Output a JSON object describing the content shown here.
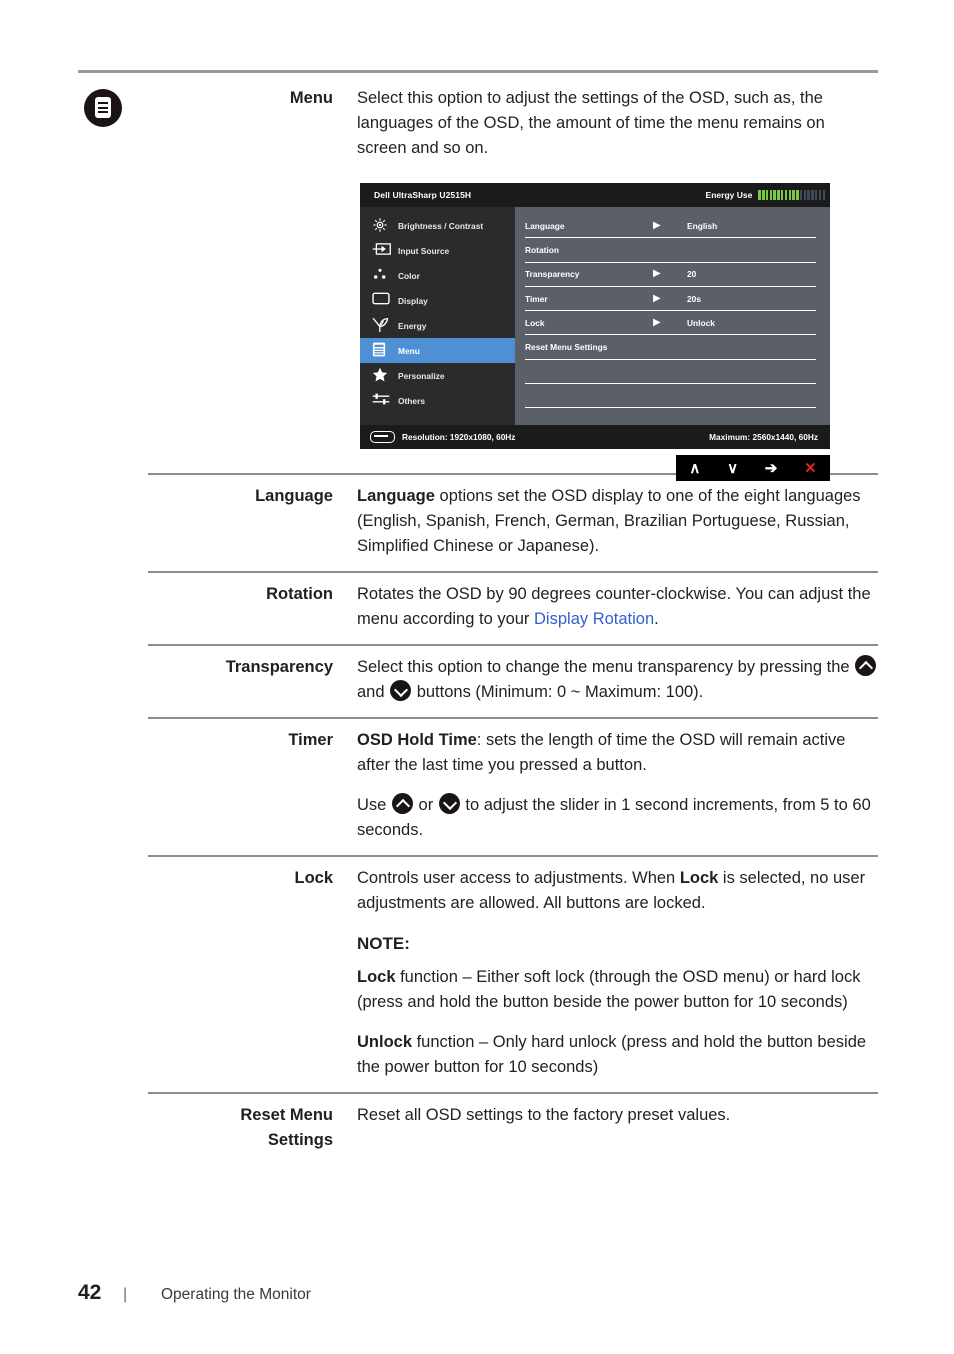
{
  "page": {
    "number": "42",
    "separator": "|",
    "section_title": "Operating the Monitor"
  },
  "rows": [
    {
      "icon": "menu-icon",
      "term": "Menu",
      "description": "Select this option to adjust the settings of the OSD, such as, the languages of the OSD, the amount of time the menu remains on screen and so on."
    },
    {
      "term": "Language",
      "desc_bold": "Language",
      "desc_rest": " options set the OSD display to one of the eight languages (English, Spanish, French, German, Brazilian Portuguese, Russian, Simplified Chinese or Japanese)."
    },
    {
      "term": "Rotation",
      "desc_pre": "Rotates the OSD by 90 degrees counter-clockwise. You can adjust the menu according to your ",
      "desc_link": "Display Rotation",
      "desc_post": "."
    },
    {
      "term": "Transparency",
      "desc_pre": "Select this option to change the menu transparency by pressing the ",
      "desc_mid": " and ",
      "desc_post": " buttons (Minimum: 0 ~ Maximum: 100)."
    },
    {
      "term": "Timer",
      "p1_bold": "OSD Hold Time",
      "p1_rest": ": sets the length of time the OSD will remain active after the last time you pressed a button.",
      "p2_pre": "Use ",
      "p2_mid": " or ",
      "p2_post": " to adjust the slider in 1 second increments, from 5 to 60 seconds."
    },
    {
      "term": "Lock",
      "p1_pre": "Controls user access to adjustments. When ",
      "p1_bold": "Lock",
      "p1_post": " is selected, no user adjustments are allowed. All buttons are locked.",
      "note_head": "NOTE:",
      "p2_bold": "Lock",
      "p2_rest": " function – Either soft lock (through the OSD menu) or hard lock (press and hold the button beside the power button for 10 seconds)",
      "p3_bold": "Unlock",
      "p3_rest": " function – Only hard unlock (press and hold the button beside the power button for 10 seconds)"
    },
    {
      "term_line1": "Reset Menu",
      "term_line2": "Settings",
      "description": "Reset all OSD settings to the factory preset values."
    }
  ],
  "osd": {
    "title": "Dell UltraSharp U2515H",
    "energy_label": "Energy Use",
    "energy_bars_active": 11,
    "energy_bars_inactive": 7,
    "energy_active_color": "#7ac943",
    "energy_inactive_color": "#3c4a5a",
    "highlight_color": "#4d90d4",
    "nav_items": [
      {
        "label": "Brightness / Contrast",
        "icon": "brightness-icon",
        "active": false
      },
      {
        "label": "Input Source",
        "icon": "input-source-icon",
        "active": false
      },
      {
        "label": "Color",
        "icon": "color-icon",
        "active": false
      },
      {
        "label": "Display",
        "icon": "display-icon",
        "active": false
      },
      {
        "label": "Energy",
        "icon": "energy-leaf-icon",
        "active": false
      },
      {
        "label": "Menu",
        "icon": "menu-icon",
        "active": true
      },
      {
        "label": "Personalize",
        "icon": "star-icon",
        "active": false
      },
      {
        "label": "Others",
        "icon": "sliders-icon",
        "active": false
      }
    ],
    "options": [
      {
        "name": "Language",
        "arrow": "▶",
        "value": "English"
      },
      {
        "name": "Rotation",
        "arrow": "",
        "value": ""
      },
      {
        "name": "Transparency",
        "arrow": "▶",
        "value": "20"
      },
      {
        "name": "Timer",
        "arrow": "▶",
        "value": "20s"
      },
      {
        "name": "Lock",
        "arrow": "▶",
        "value": "Unlock"
      },
      {
        "name": "Reset Menu Settings",
        "arrow": "",
        "value": ""
      },
      {
        "name": "",
        "arrow": "",
        "value": ""
      },
      {
        "name": "",
        "arrow": "",
        "value": ""
      }
    ],
    "footer": {
      "resolution": "Resolution: 1920x1080, 60Hz",
      "maximum": "Maximum: 2560x1440, 60Hz"
    },
    "nav_buttons": [
      {
        "glyph": "∧",
        "name": "up-button"
      },
      {
        "glyph": "∨",
        "name": "down-button"
      },
      {
        "glyph": "➔",
        "name": "enter-button"
      },
      {
        "glyph": "✕",
        "name": "exit-button"
      }
    ]
  }
}
